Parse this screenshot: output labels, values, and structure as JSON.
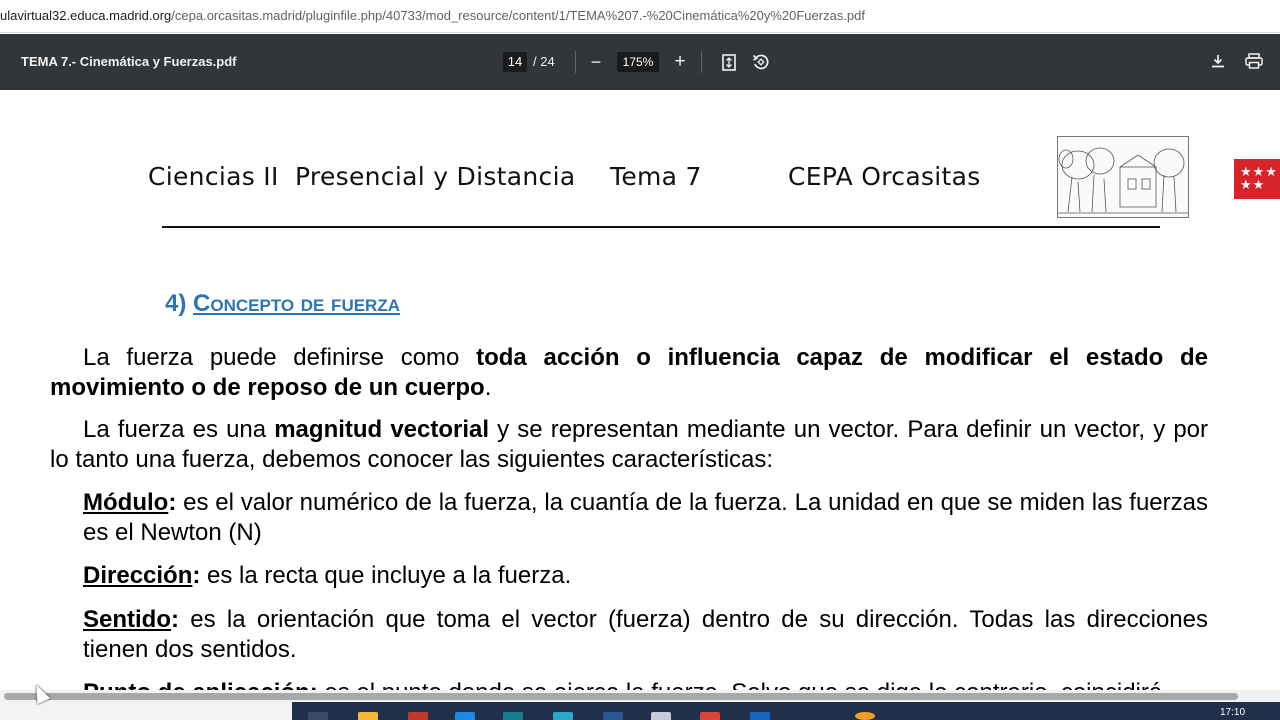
{
  "browser": {
    "url_prefix": "ulavirtual32.educa.madrid.org",
    "url_path": "/cepa.orcasitas.madrid/pluginfile.php/40733/mod_resource/content/1/TEMA%207.-%20Cinemática%20y%20Fuerzas.pdf"
  },
  "toolbar": {
    "title": "TEMA 7.- Cinemática y Fuerzas.pdf",
    "page_current": "14",
    "page_total": "/ 24",
    "zoom": "175%",
    "zoom_out_icon": "−",
    "zoom_in_icon": "+",
    "fit_icon": "fit-page-icon",
    "rotate_icon": "rotate-icon",
    "download_icon": "download-icon",
    "print_icon": "print-icon"
  },
  "document": {
    "header": {
      "course": "Ciencias II",
      "mode": "Presencial y Distancia",
      "topic": "Tema 7",
      "school": "CEPA Orcasitas"
    },
    "section": {
      "number": "4)",
      "title": "Concepto de fuerza"
    },
    "p1": {
      "a": "La fuerza puede definirse como ",
      "b": "toda acción o influencia capaz de modificar el estado de movimiento o de reposo de un cuerpo",
      "c": "."
    },
    "p2": {
      "a": "La fuerza es una ",
      "b": "magnitud vectorial",
      "c": " y se representan mediante un vector. Para definir un vector, y por lo tanto una fuerza, debemos conocer las siguientes características:"
    },
    "definitions": [
      {
        "term": "Módulo",
        "text": " es el valor numérico de la fuerza, la cuantía de la fuerza. La unidad en que se miden las fuerzas es el Newton (N)"
      },
      {
        "term": "Dirección",
        "text": " es la recta que incluye a la fuerza."
      },
      {
        "term": "Sentido",
        "text": " es la orientación que toma el vector (fuerza) dentro de su dirección. Todas las direcciones tienen dos sentidos."
      },
      {
        "term": "Punto de aplicación",
        "text": " es el punto donde se ejerce la fuerza. Salvo que se diga lo contrario, coincidirá"
      }
    ]
  },
  "taskbar": {
    "time": "17:10"
  }
}
